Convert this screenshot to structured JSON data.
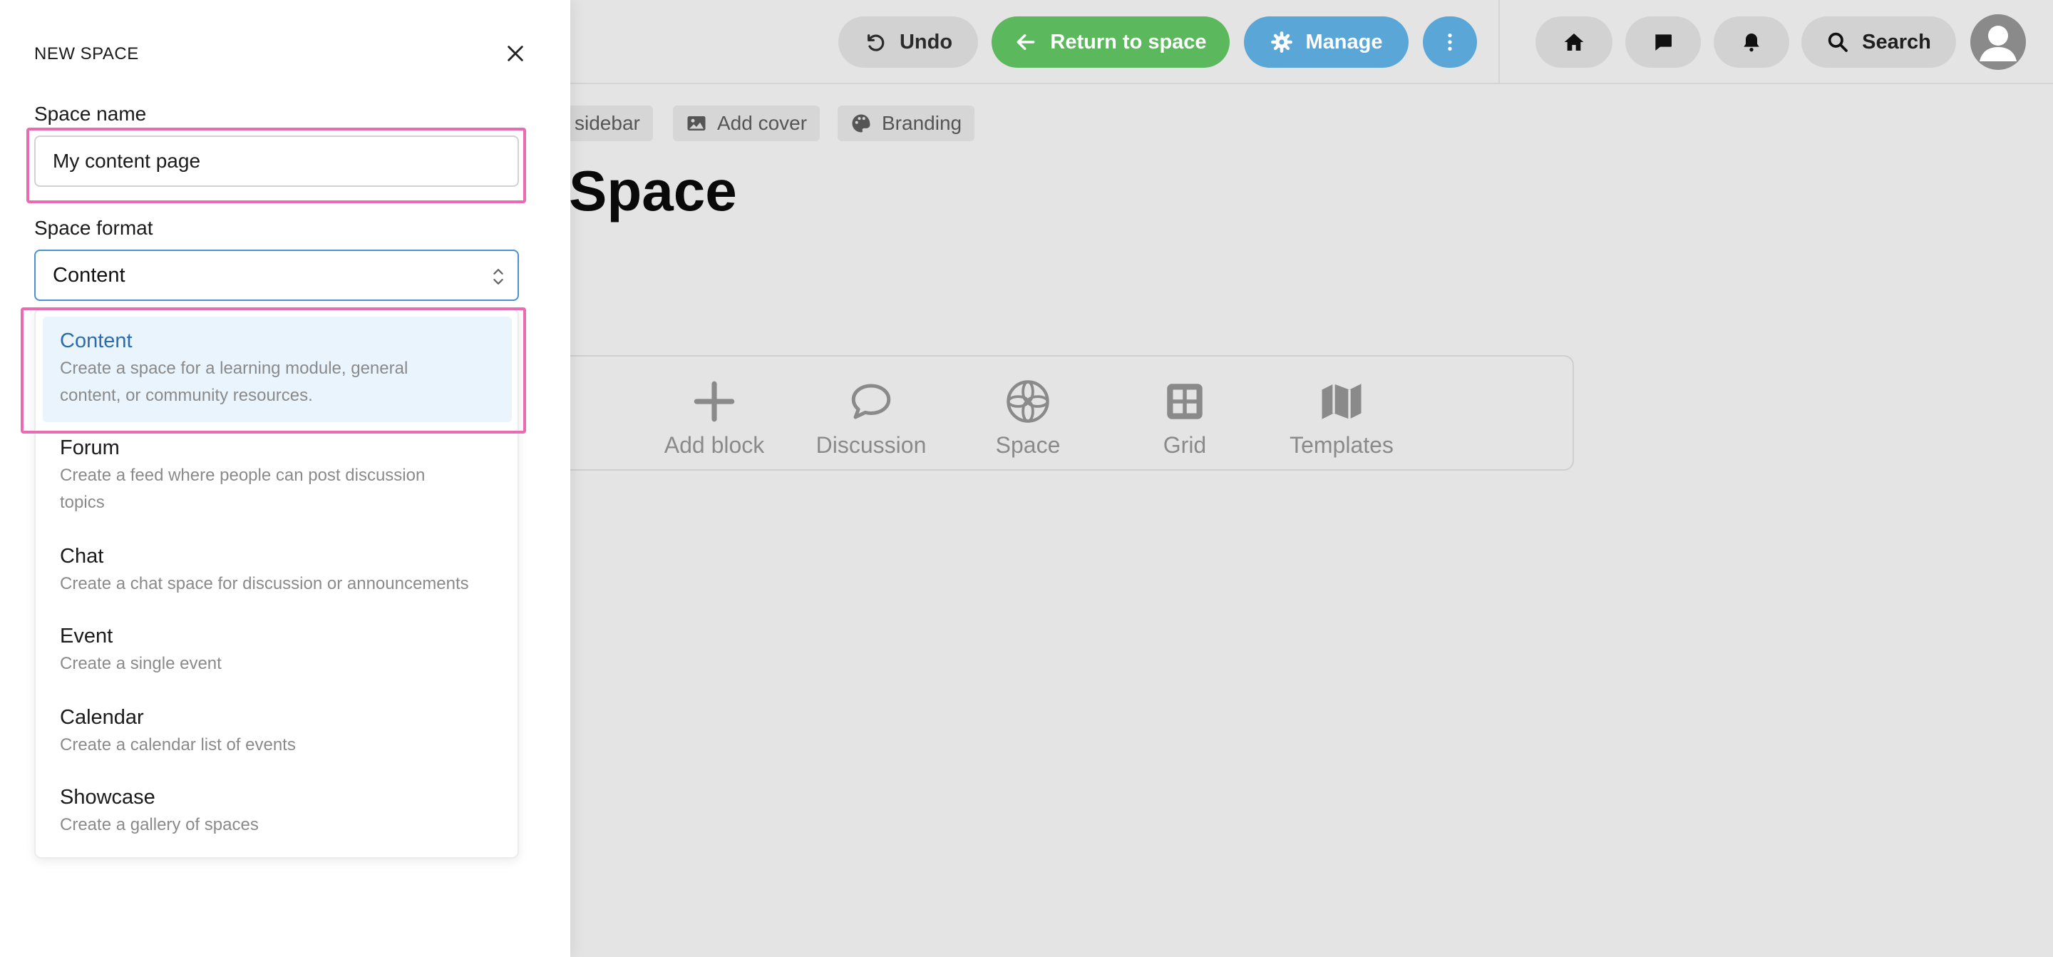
{
  "topbar": {
    "undo_label": "Undo",
    "return_label": "Return to space",
    "manage_label": "Manage",
    "search_label": "Search"
  },
  "page_toolbar": {
    "sidebar_label": "sidebar",
    "cover_label": "Add cover",
    "branding_label": "Branding"
  },
  "page": {
    "title": "Space"
  },
  "blocks": [
    {
      "label": "Add block",
      "icon": "plus-icon"
    },
    {
      "label": "Discussion",
      "icon": "speech-bubble-icon"
    },
    {
      "label": "Space",
      "icon": "flower-icon"
    },
    {
      "label": "Grid",
      "icon": "grid-icon"
    },
    {
      "label": "Templates",
      "icon": "map-icon"
    }
  ],
  "panel": {
    "title": "NEW SPACE",
    "space_name_label": "Space name",
    "space_name_value": "My content page",
    "space_format_label": "Space format",
    "space_format_value": "Content",
    "options": [
      {
        "title": "Content",
        "desc_1": "Create a space for a learning module, general",
        "desc_2": "content, or community resources."
      },
      {
        "title": "Forum",
        "desc_1": "Create a feed where people can post discussion",
        "desc_2": "topics"
      },
      {
        "title": "Chat",
        "desc_1": "Create a chat space for discussion or announcements"
      },
      {
        "title": "Event",
        "desc_1": "Create a single event"
      },
      {
        "title": "Calendar",
        "desc_1": "Create a calendar list of events"
      },
      {
        "title": "Showcase",
        "desc_1": "Create a gallery of spaces"
      }
    ]
  },
  "colors": {
    "highlight": "#e96bb2",
    "return_green": "#5cb85c",
    "manage_blue": "#5aa6d6",
    "selected_option_bg": "#eaf4fd"
  }
}
